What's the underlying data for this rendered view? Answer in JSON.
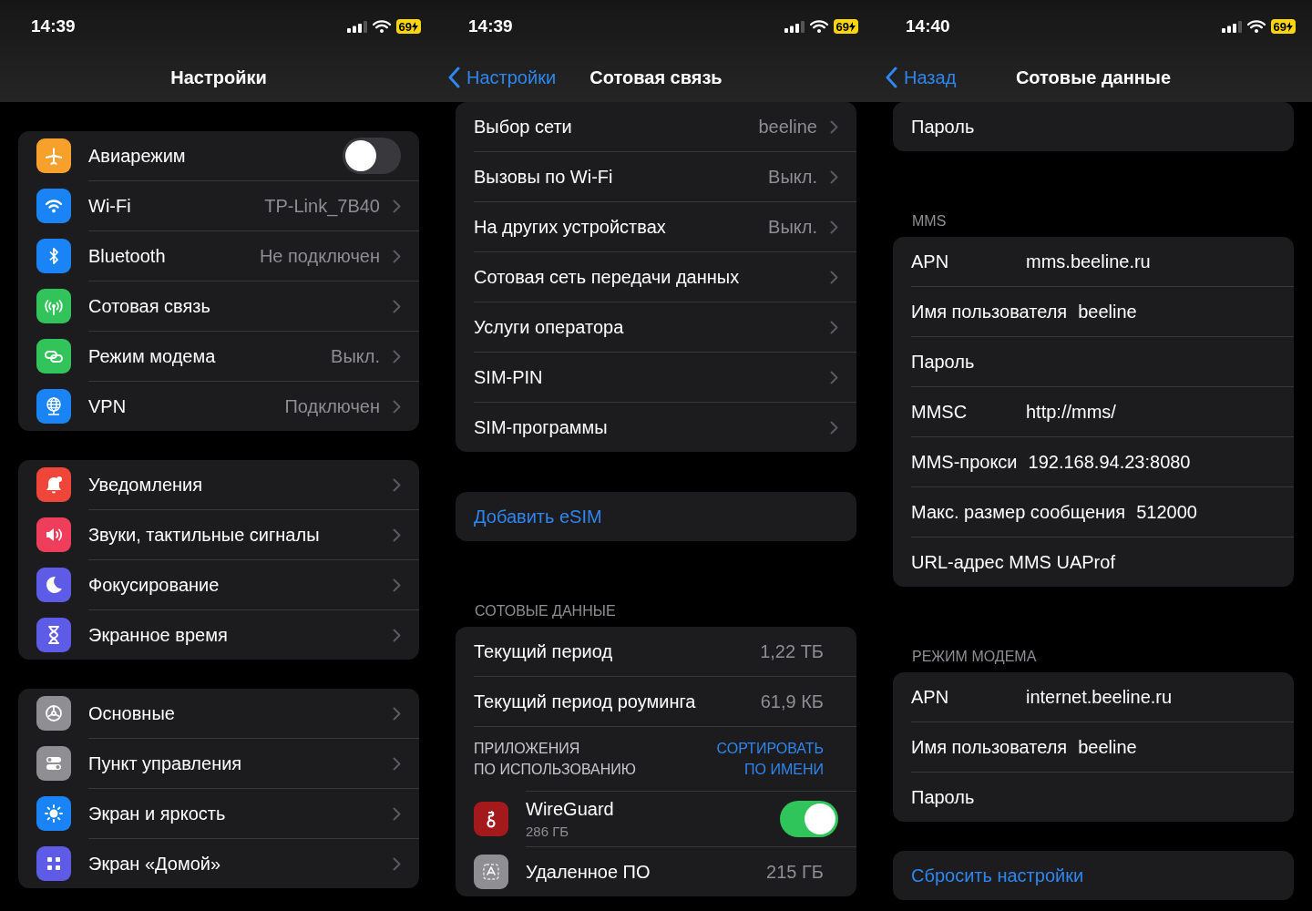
{
  "screens": [
    {
      "status_bar": {
        "time": "14:39",
        "battery": "69"
      },
      "nav": {
        "title": "Настройки"
      },
      "groups": [
        {
          "rows": [
            {
              "kind": "toggle",
              "label": "Авиарежим",
              "on": false,
              "color": "#f7a02c"
            },
            {
              "kind": "link",
              "label": "Wi-Fi",
              "value": "TP-Link_7B40",
              "color": "#1a84f7"
            },
            {
              "kind": "link",
              "label": "Bluetooth",
              "value": "Не подключен",
              "color": "#1a84f7"
            },
            {
              "kind": "link",
              "label": "Сотовая связь",
              "color": "#32c45a"
            },
            {
              "kind": "link",
              "label": "Режим модема",
              "value": "Выкл.",
              "color": "#32c45a"
            },
            {
              "kind": "link",
              "label": "VPN",
              "value": "Подключен",
              "color": "#1a84f7"
            }
          ]
        },
        {
          "rows": [
            {
              "kind": "link",
              "label": "Уведомления",
              "color": "#f04539"
            },
            {
              "kind": "link",
              "label": "Звуки, тактильные сигналы",
              "color": "#ef3e5c"
            },
            {
              "kind": "link",
              "label": "Фокусирование",
              "color": "#5e5ce6"
            },
            {
              "kind": "link",
              "label": "Экранное время",
              "color": "#5e5ce6"
            }
          ]
        },
        {
          "rows": [
            {
              "kind": "link",
              "label": "Основные",
              "color": "#8e8e93"
            },
            {
              "kind": "link",
              "label": "Пункт управления",
              "color": "#8e8e93"
            },
            {
              "kind": "link",
              "label": "Экран и яркость",
              "color": "#1a84f7"
            },
            {
              "kind": "link",
              "label": "Экран «Домой»",
              "color": "#5e5ce6"
            }
          ]
        }
      ]
    },
    {
      "status_bar": {
        "time": "14:39",
        "battery": "69"
      },
      "nav": {
        "back": "Настройки",
        "title": "Сотовая связь"
      },
      "groups": [
        {
          "rows": [
            {
              "kind": "link",
              "label": "Выбор сети",
              "value": "beeline"
            },
            {
              "kind": "link",
              "label": "Вызовы по Wi-Fi",
              "value": "Выкл."
            },
            {
              "kind": "link",
              "label": "На других устройствах",
              "value": "Выкл."
            },
            {
              "kind": "link",
              "label": "Сотовая сеть передачи данных"
            },
            {
              "kind": "link",
              "label": "Услуги оператора"
            },
            {
              "kind": "link",
              "label": "SIM-PIN"
            },
            {
              "kind": "link",
              "label": "SIM-программы"
            }
          ]
        },
        {
          "rows": [
            {
              "kind": "action",
              "label": "Добавить eSIM"
            }
          ]
        },
        {
          "header": "СОТОВЫЕ ДАННЫЕ",
          "rows": [
            {
              "kind": "stat",
              "label": "Текущий период",
              "value": "1,22 ТБ"
            },
            {
              "kind": "stat",
              "label": "Текущий период роуминга",
              "value": "61,9 КБ"
            },
            {
              "kind": "apps_header",
              "label": "ПРИЛОЖЕНИЯ\nПО ИСПОЛЬЗОВАНИЮ",
              "action": "СОРТИРОВАТЬ\nПО ИМЕНИ"
            },
            {
              "kind": "app",
              "label": "WireGuard",
              "subtitle": "286 ГБ",
              "on": true,
              "color": "#a3191c"
            },
            {
              "kind": "app",
              "label": "Удаленное ПО",
              "value": "215 ГБ",
              "color": "#8e8e93"
            }
          ]
        }
      ]
    },
    {
      "status_bar": {
        "time": "14:40",
        "battery": "69"
      },
      "nav": {
        "back": "Назад",
        "title": "Сотовые данные"
      },
      "groups": [
        {
          "rows": [
            {
              "kind": "field",
              "label": "Пароль"
            }
          ]
        },
        {
          "header": "MMS",
          "rows": [
            {
              "kind": "field",
              "label": "APN",
              "value": "mms.beeline.ru"
            },
            {
              "kind": "field",
              "label": "Имя пользователя",
              "value": "beeline"
            },
            {
              "kind": "field",
              "label": "Пароль"
            },
            {
              "kind": "field",
              "label": "MMSC",
              "value": "http://mms/"
            },
            {
              "kind": "field",
              "label": "MMS-прокси",
              "value": "192.168.94.23:8080"
            },
            {
              "kind": "field",
              "label": "Макс. размер сообщения",
              "value": "512000"
            },
            {
              "kind": "field",
              "label": "URL-адрес MMS UAProf"
            }
          ]
        },
        {
          "header": "РЕЖИМ МОДЕМА",
          "rows": [
            {
              "kind": "field",
              "label": "APN",
              "value": "internet.beeline.ru"
            },
            {
              "kind": "field",
              "label": "Имя пользователя",
              "value": "beeline"
            },
            {
              "kind": "field",
              "label": "Пароль"
            }
          ]
        },
        {
          "rows": [
            {
              "kind": "action",
              "label": "Сбросить настройки"
            }
          ]
        }
      ]
    }
  ]
}
